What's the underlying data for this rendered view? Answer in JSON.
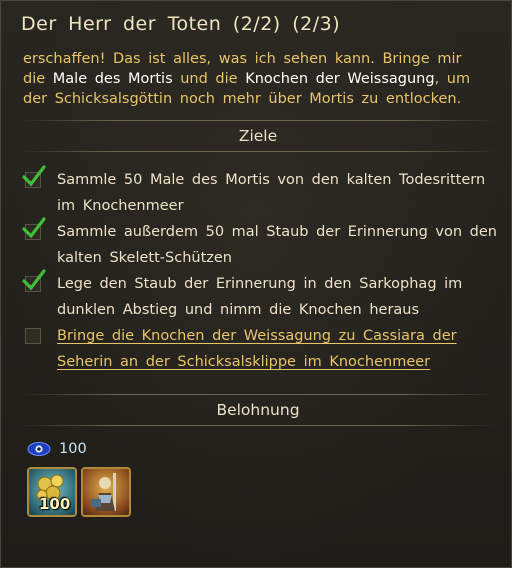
{
  "quest": {
    "title": "Der Herr der Toten (2/2) (2/3)",
    "description_parts": {
      "p1": "erschaffen! Das ist alles, was ich sehen kann. Bringe mir die ",
      "hl1": "Male des Mortis",
      "p2": " und die ",
      "hl2": "Knochen der Weissagung",
      "p3": ", um der Schicksalsgöttin noch mehr über Mortis zu entlocken."
    }
  },
  "objectives": {
    "header": "Ziele",
    "items": [
      {
        "text": "Sammle 50 Male des Mortis von den kalten Todesrittern im Knochenmeer",
        "completed": true
      },
      {
        "text": "Sammle außerdem 50 mal Staub der Erinnerung von den kalten Skelett-Schützen",
        "completed": true
      },
      {
        "text": "Lege den Staub der Erinnerung in den Sarkophag im dunklen Abstieg und nimm die Knochen heraus",
        "completed": true
      },
      {
        "text": "Bringe die Knochen der Weissagung zu Cassiara der Seherin an der Schicksalsklippe im Knochenmeer",
        "completed": false
      }
    ]
  },
  "reward": {
    "header": "Belohnung",
    "experience": "100",
    "experience_icon": "eye-icon",
    "items": [
      {
        "icon": "gold-nuggets-icon",
        "quantity": "100"
      },
      {
        "icon": "warrior-portrait-icon",
        "quantity": ""
      }
    ]
  },
  "colors": {
    "highlight": "#ffffff",
    "description": "#e9c468",
    "check": "#3fbf3a"
  }
}
